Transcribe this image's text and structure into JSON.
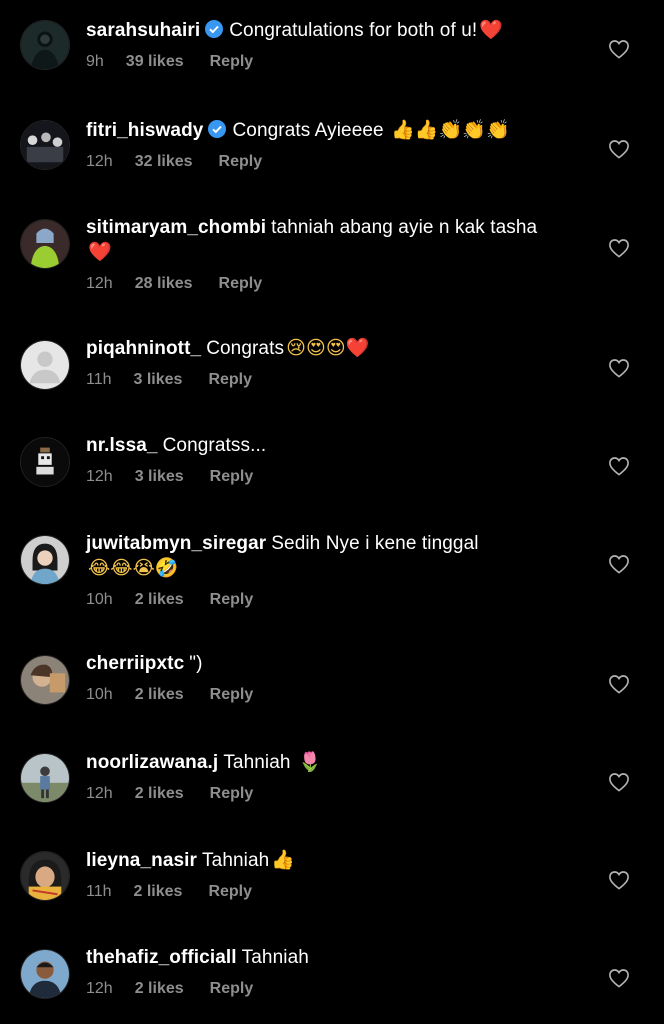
{
  "colors": {
    "background": "#000000",
    "text": "#ffffff",
    "muted": "#8e8e8e",
    "verified": "#3897f0",
    "heart_emoji": "#ed2e40"
  },
  "comments": [
    {
      "username": "sarahsuhairi",
      "verified": true,
      "text": "Congratulations for both of u!",
      "emojis": "❤️",
      "time": "9h",
      "likes": "39 likes",
      "reply": "Reply",
      "avatar_icon": "avatar-person-dark"
    },
    {
      "username": "fitri_hiswady",
      "verified": true,
      "text": "Congrats Ayieeee",
      "emojis": "👍👍👏👏👏",
      "time": "12h",
      "likes": "32 likes",
      "reply": "Reply",
      "avatar_icon": "avatar-group-photo"
    },
    {
      "username": "sitimaryam_chombi",
      "verified": false,
      "text": "tahniah abang ayie n kak tasha",
      "emojis": "❤️",
      "time": "12h",
      "likes": "28 likes",
      "reply": "Reply",
      "avatar_icon": "avatar-person-green"
    },
    {
      "username": "piqahninott_",
      "verified": false,
      "text": "Congrats",
      "emojis": "😢😍😍❤️",
      "time": "11h",
      "likes": "3 likes",
      "reply": "Reply",
      "avatar_icon": "avatar-default"
    },
    {
      "username": "nr.lssa_",
      "verified": false,
      "text": "Congratss...",
      "emojis": "",
      "time": "12h",
      "likes": "3 likes",
      "reply": "Reply",
      "avatar_icon": "avatar-cartoon"
    },
    {
      "username": "juwitabmyn_siregar",
      "verified": false,
      "text": "Sedih Nye i kene tinggal",
      "emojis": "😂😂😭🤣",
      "time": "10h",
      "likes": "2 likes",
      "reply": "Reply",
      "avatar_icon": "avatar-person-scarf"
    },
    {
      "username": "cherriipxtc",
      "verified": false,
      "text": "\")",
      "emojis": "",
      "time": "10h",
      "likes": "2 likes",
      "reply": "Reply",
      "avatar_icon": "avatar-person-brown"
    },
    {
      "username": "noorlizawana.j",
      "verified": false,
      "text": "Tahniah",
      "emojis": "🌷",
      "time": "12h",
      "likes": "2 likes",
      "reply": "Reply",
      "avatar_icon": "avatar-person-outdoor"
    },
    {
      "username": "lieyna_nasir",
      "verified": false,
      "text": "Tahniah",
      "emojis": "👍",
      "time": "11h",
      "likes": "2 likes",
      "reply": "Reply",
      "avatar_icon": "avatar-person-hijab"
    },
    {
      "username": "thehafiz_officiall",
      "verified": false,
      "text": "Tahniah",
      "emojis": "",
      "time": "12h",
      "likes": "2 likes",
      "reply": "Reply",
      "avatar_icon": "avatar-person-blue"
    }
  ]
}
